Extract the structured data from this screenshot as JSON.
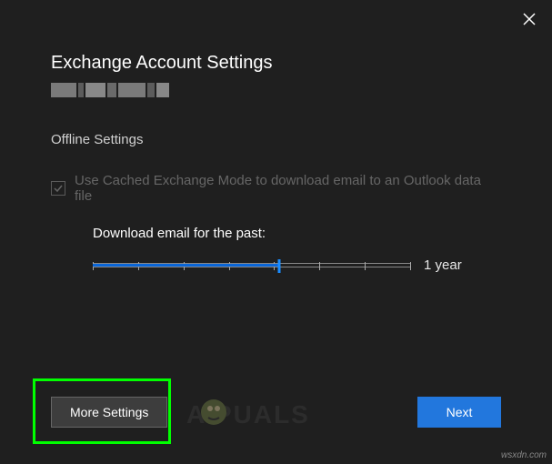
{
  "dialog": {
    "title": "Exchange Account Settings",
    "section_label": "Offline Settings",
    "cached_mode_label": "Use Cached Exchange Mode to download email to an Outlook data file",
    "cached_mode_checked": true,
    "download_label": "Download email for the past:",
    "slider_value_label": "1 year"
  },
  "buttons": {
    "more_settings": "More Settings",
    "next": "Next"
  },
  "watermark": {
    "text": "A  PUALS",
    "site": "wsxdn.com"
  }
}
